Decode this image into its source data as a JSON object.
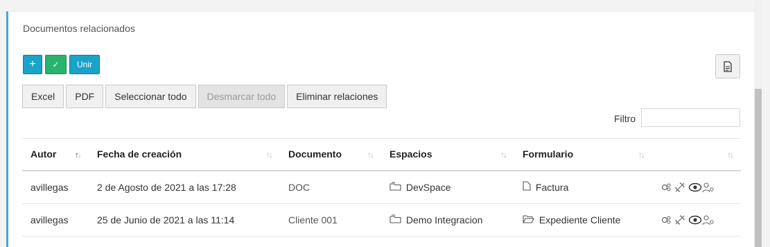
{
  "panel": {
    "title": "Documentos relacionados"
  },
  "buttons": {
    "add": "+",
    "check": "✓",
    "join": "Unir"
  },
  "toolbar": {
    "excel": "Excel",
    "pdf": "PDF",
    "select_all": "Seleccionar todo",
    "unselect_all": "Desmarcar todo",
    "delete_relations": "Eliminar relaciones"
  },
  "filter": {
    "label": "Filtro",
    "value": ""
  },
  "table": {
    "headers": [
      "Autor",
      "Fecha de creación",
      "Documento",
      "Espacios",
      "Formulario",
      ""
    ],
    "rows": [
      {
        "autor": "avillegas",
        "fecha": "2 de Agosto de 2021 a las 17:28",
        "documento": "DOC",
        "espacio": "DevSpace",
        "formulario": "Factura"
      },
      {
        "autor": "avillegas",
        "fecha": "25 de Junio de 2021 a las 11:14",
        "documento": "Cliente 001",
        "espacio": "Demo Integracion",
        "formulario": "Expediente Cliente"
      }
    ]
  },
  "colors": {
    "accent_blue": "#1aa3c9",
    "accent_green": "#28b46e",
    "panel_border": "#4aa1d8"
  }
}
